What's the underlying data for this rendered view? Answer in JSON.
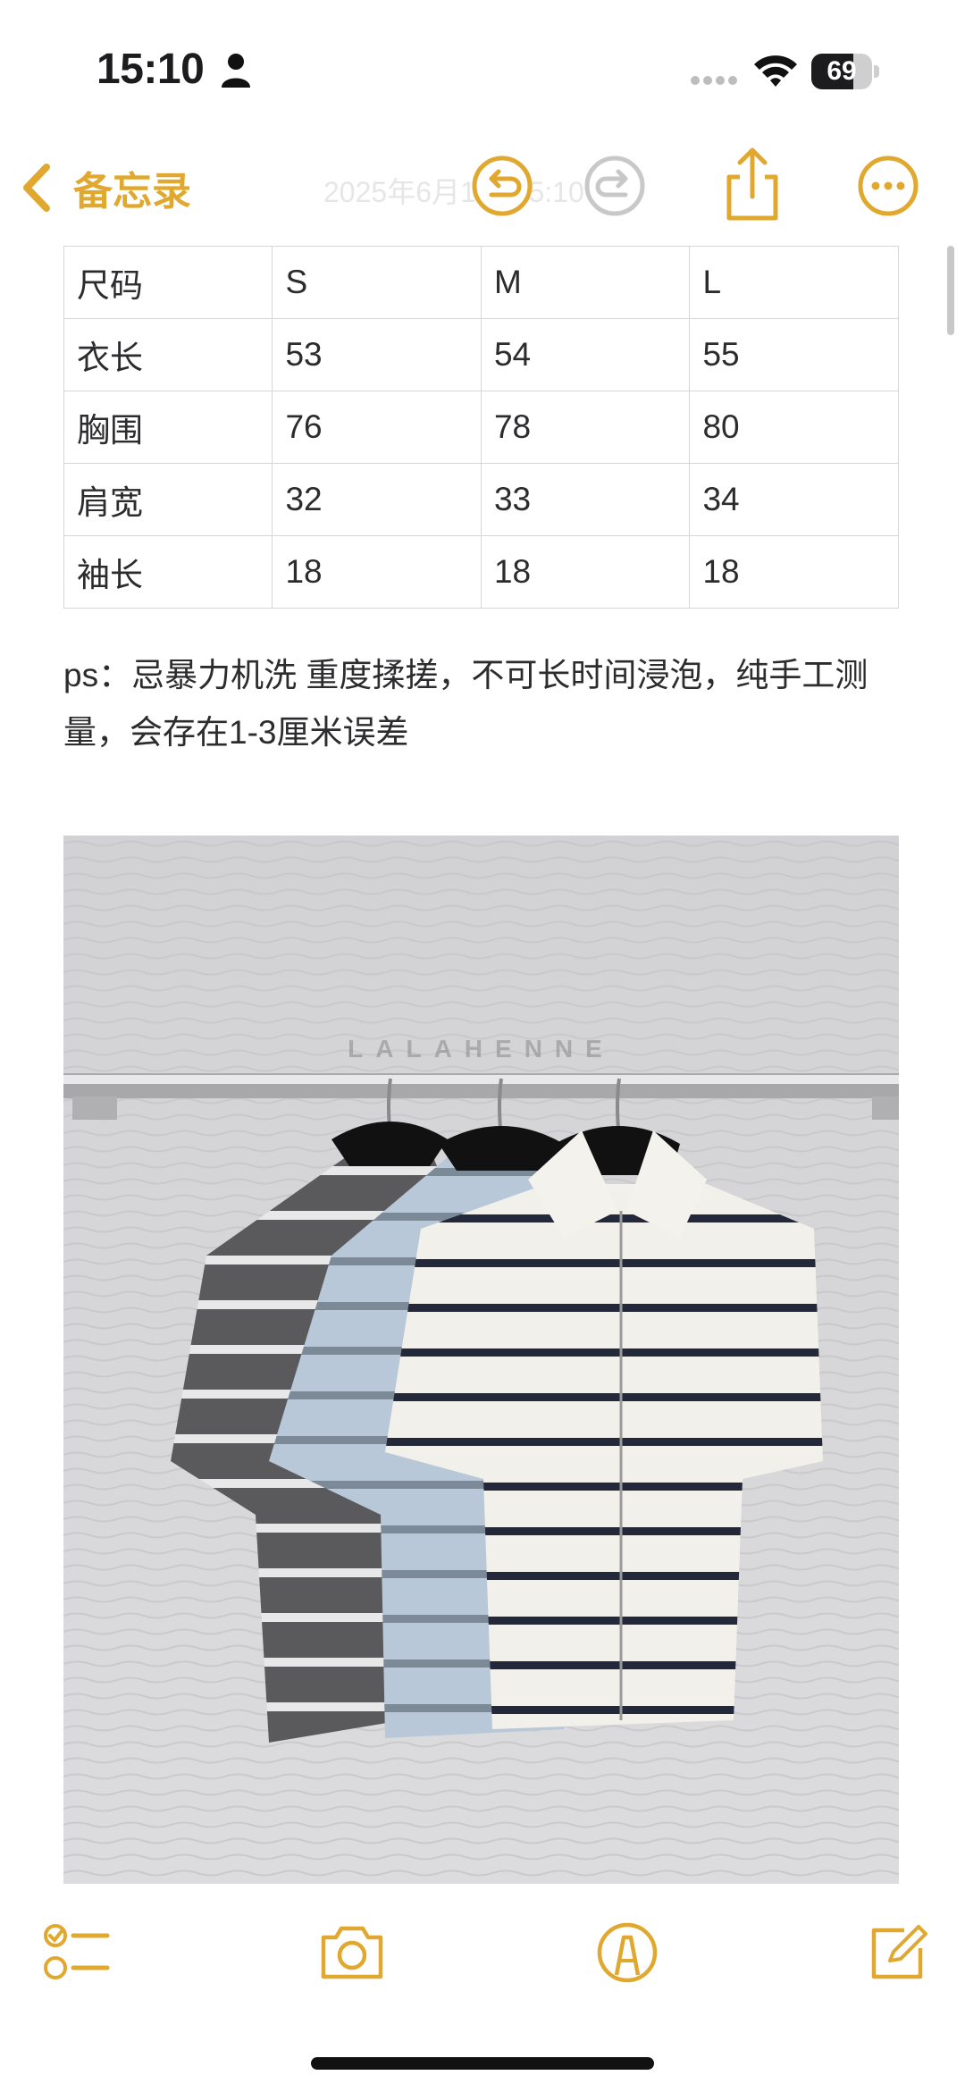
{
  "status_bar": {
    "time": "15:10",
    "battery_level": "69",
    "icons": [
      "person-icon",
      "signal-dots-icon",
      "wifi-icon",
      "battery-icon"
    ]
  },
  "nav": {
    "back_label": "备忘录",
    "faded_date": "2025年6月1日 15:10",
    "icons": [
      "chevron-left-icon",
      "undo-icon",
      "redo-icon",
      "share-icon",
      "more-icon"
    ]
  },
  "colors": {
    "accent": "#e0a82e",
    "text": "#2c2c2e",
    "grid": "#d6d6d6"
  },
  "table": {
    "rows": [
      [
        "尺码",
        "S",
        "M",
        "L"
      ],
      [
        "衣长",
        "53",
        "54",
        "55"
      ],
      [
        "胸围",
        "76",
        "78",
        "80"
      ],
      [
        "肩宽",
        "32",
        "33",
        "34"
      ],
      [
        "袖长",
        "18",
        "18",
        "18"
      ]
    ]
  },
  "note": {
    "text": "ps：忌暴力机洗 重度揉搓，不可长时间浸泡，纯手工测量，会存在1-3厘米误差"
  },
  "photo": {
    "watermark": "LALAHENNE"
  },
  "toolbar": {
    "icons": [
      "checklist-icon",
      "camera-icon",
      "markup-icon",
      "compose-icon"
    ]
  }
}
